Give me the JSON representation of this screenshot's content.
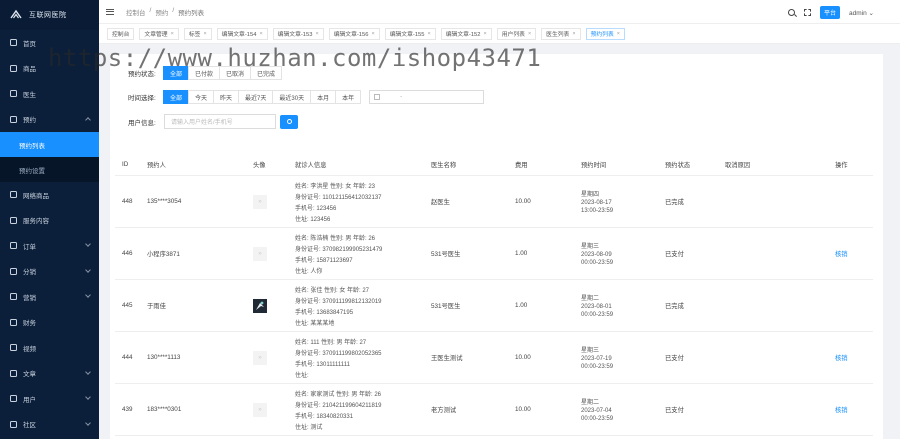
{
  "app": {
    "logo_text": "互联网医院"
  },
  "sidebar": {
    "items": [
      {
        "label": "首页"
      },
      {
        "label": "商品"
      },
      {
        "label": "医生"
      },
      {
        "label": "预约",
        "open": true
      },
      {
        "label": "网络商品"
      },
      {
        "label": "服务内容"
      },
      {
        "label": "订单"
      },
      {
        "label": "分销"
      },
      {
        "label": "营销"
      },
      {
        "label": "财务"
      },
      {
        "label": "视频"
      },
      {
        "label": "文章"
      },
      {
        "label": "用户"
      },
      {
        "label": "社区"
      }
    ],
    "subitems": [
      {
        "label": "预约列表"
      },
      {
        "label": "预约设置"
      }
    ]
  },
  "topbar": {
    "breadcrumb": [
      "控制台",
      "预约",
      "预约列表"
    ],
    "platform": "平台",
    "user": "admin"
  },
  "tabs": [
    {
      "label": "控制台"
    },
    {
      "label": "文章管理"
    },
    {
      "label": "标签"
    },
    {
      "label": "编辑文章-154"
    },
    {
      "label": "编辑文章-153"
    },
    {
      "label": "编辑文章-156"
    },
    {
      "label": "编辑文章-155"
    },
    {
      "label": "编辑文章-152"
    },
    {
      "label": "用户列表"
    },
    {
      "label": "医生列表"
    },
    {
      "label": "预约列表"
    }
  ],
  "filters": {
    "status": {
      "label": "预约状态:",
      "options": [
        "全部",
        "已付款",
        "已取消",
        "已完成"
      ]
    },
    "time": {
      "label": "时间选择:",
      "options": [
        "全部",
        "今天",
        "昨天",
        "最近7天",
        "最近30天",
        "本月",
        "本年"
      ],
      "date_placeholder": "-"
    },
    "user": {
      "label": "用户信息:",
      "placeholder": "请输入用户姓名/手机号"
    }
  },
  "table": {
    "headers": [
      "ID",
      "预约人",
      "头像",
      "就诊人信息",
      "医生名称",
      "费用",
      "预约时间",
      "预约状态",
      "取消原因",
      "操作"
    ],
    "rows": [
      {
        "id": "448",
        "name": "135****3054",
        "avatar": false,
        "info": [
          "姓名: 李洪星 性别: 女 年龄: 23",
          "身份证号: 110121156412032137",
          "手机号: 123456",
          "住址: 123456"
        ],
        "doctor": "赵医生",
        "fee": "10.00",
        "time": [
          "星期四",
          "2023-08-17",
          "13:00-23:59"
        ],
        "status": "已完成",
        "reason": "",
        "op": ""
      },
      {
        "id": "446",
        "name": "小程序3871",
        "avatar": false,
        "info": [
          "姓名: 陈浩楠 性别: 男 年龄: 26",
          "身份证号: 370982199905231479",
          "手机号: 15871123697",
          "住址: 人你"
        ],
        "doctor": "531号医生",
        "fee": "1.00",
        "time": [
          "星期三",
          "2023-08-09",
          "00:00-23:59"
        ],
        "status": "已支付",
        "reason": "",
        "op": "核销"
      },
      {
        "id": "445",
        "name": "于雨佳",
        "avatar": true,
        "info": [
          "姓名: 张佳 性别: 女 年龄: 27",
          "身份证号: 370911199812132019",
          "手机号: 13683847195",
          "住址: 某某某地"
        ],
        "doctor": "531号医生",
        "fee": "1.00",
        "time": [
          "星期二",
          "2023-08-01",
          "00:00-23:59"
        ],
        "status": "已完成",
        "reason": "",
        "op": ""
      },
      {
        "id": "444",
        "name": "130****1113",
        "avatar": false,
        "info": [
          "姓名: 111 性别: 男 年龄: 27",
          "身份证号: 370911199802052365",
          "手机号: 13011111111",
          "住址:"
        ],
        "doctor": "王医生测试",
        "fee": "10.00",
        "time": [
          "星期三",
          "2023-07-19",
          "00:00-23:59"
        ],
        "status": "已支付",
        "reason": "",
        "op": "核销"
      },
      {
        "id": "439",
        "name": "183****0301",
        "avatar": false,
        "info": [
          "姓名: 家家测试 性别: 男 年龄: 26",
          "身份证号: 210421199604211819",
          "手机号: 18340820331",
          "住址: 测试"
        ],
        "doctor": "老方测试",
        "fee": "10.00",
        "time": [
          "星期二",
          "2023-07-04",
          "00:00-23:59"
        ],
        "status": "已支付",
        "reason": "",
        "op": "核销"
      }
    ]
  },
  "watermark": "https://www.huzhan.com/ishop43471",
  "colors": {
    "accent": "#1890ff",
    "sidebar_bg": "#0b1f3a"
  }
}
